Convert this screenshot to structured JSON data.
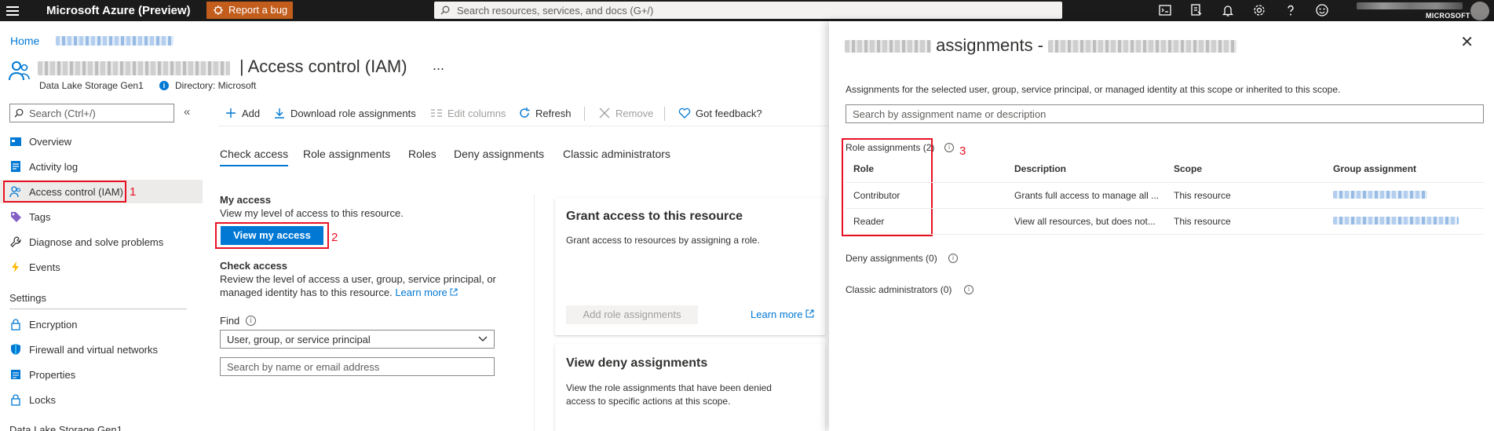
{
  "topbar": {
    "brand": "Microsoft Azure (Preview)",
    "bug_label": "Report a bug",
    "search_placeholder": "Search resources, services, and docs (G+/)",
    "org": "MICROSOFT"
  },
  "breadcrumb": {
    "home": "Home"
  },
  "header": {
    "title": "| Access control (IAM)",
    "more": "...",
    "subtitle": "Data Lake Storage Gen1",
    "directory": "Directory: Microsoft"
  },
  "nav": {
    "search_placeholder": "Search (Ctrl+/)",
    "collapse": "«",
    "items": [
      {
        "label": "Overview",
        "icon": "overview-icon"
      },
      {
        "label": "Activity log",
        "icon": "activity-log-icon"
      },
      {
        "label": "Access control (IAM)",
        "icon": "people-icon"
      },
      {
        "label": "Tags",
        "icon": "tag-icon"
      },
      {
        "label": "Diagnose and solve problems",
        "icon": "wrench-icon"
      },
      {
        "label": "Events",
        "icon": "lightning-icon"
      }
    ],
    "settings_heading": "Settings",
    "settings_items": [
      {
        "label": "Encryption",
        "icon": "lock-icon"
      },
      {
        "label": "Firewall and virtual networks",
        "icon": "shield-icon"
      },
      {
        "label": "Properties",
        "icon": "properties-icon"
      },
      {
        "label": "Locks",
        "icon": "lock-icon"
      }
    ],
    "section2_heading": "Data Lake Storage Gen1"
  },
  "steps": {
    "one": "1",
    "two": "2",
    "three": "3"
  },
  "toolbar": {
    "add": "Add",
    "download": "Download role assignments",
    "edit_columns": "Edit columns",
    "refresh": "Refresh",
    "remove": "Remove",
    "feedback": "Got feedback?"
  },
  "tabs": [
    "Check access",
    "Role assignments",
    "Roles",
    "Deny assignments",
    "Classic administrators"
  ],
  "my_access": {
    "heading": "My access",
    "desc": "View my level of access to this resource.",
    "button": "View my access"
  },
  "check_access": {
    "heading": "Check access",
    "desc_line1": "Review the level of access a user, group, service principal, or",
    "desc_line2": "managed identity has to this resource.",
    "learn_more": "Learn more",
    "find_label": "Find",
    "find_value": "User, group, or service principal",
    "search_placeholder": "Search by name or email address"
  },
  "grant_card": {
    "title": "Grant access to this resource",
    "desc": "Grant access to resources by assigning a role.",
    "button": "Add role assignments",
    "learn_more": "Learn more"
  },
  "deny_card": {
    "title": "View deny assignments",
    "desc_line1": "View the role assignments that have been denied",
    "desc_line2": "access to specific actions at this scope."
  },
  "panel": {
    "title": "assignments -",
    "close": "✕",
    "desc": "Assignments for the selected user, group, service principal, or managed identity at this scope or inherited to this scope.",
    "search_placeholder": "Search by assignment name or description",
    "role_assignments_label": "Role assignments (2)",
    "columns": [
      "Role",
      "Description",
      "Scope",
      "Group assignment"
    ],
    "rows": [
      {
        "role": "Contributor",
        "description": "Grants full access to manage all ...",
        "scope": "This resource"
      },
      {
        "role": "Reader",
        "description": "View all resources, but does not...",
        "scope": "This resource"
      }
    ],
    "deny_label": "Deny assignments (0)",
    "classic_label": "Classic administrators (0)"
  },
  "colors": {
    "accent": "#0078d4",
    "topbar": "#1b1b1b",
    "bug": "#c25d1c",
    "highlight": "#e81123"
  }
}
